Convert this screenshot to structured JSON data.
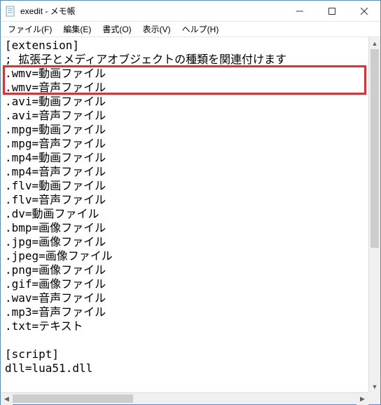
{
  "window": {
    "title": "exedit - メモ帳"
  },
  "menu": {
    "file": "ファイル(F)",
    "edit": "編集(E)",
    "format": "書式(O)",
    "view": "表示(V)",
    "help": "ヘルプ(H)"
  },
  "content": {
    "lines": [
      "[extension]",
      "; 拡張子とメディアオブジェクトの種類を関連付けます",
      ".wmv=動画ファイル",
      ".wmv=音声ファイル",
      ".avi=動画ファイル",
      ".avi=音声ファイル",
      ".mpg=動画ファイル",
      ".mpg=音声ファイル",
      ".mp4=動画ファイル",
      ".mp4=音声ファイル",
      ".flv=動画ファイル",
      ".flv=音声ファイル",
      ".dv=動画ファイル",
      ".bmp=画像ファイル",
      ".jpg=画像ファイル",
      ".jpeg=画像ファイル",
      ".png=画像ファイル",
      ".gif=画像ファイル",
      ".wav=音声ファイル",
      ".mp3=音声ファイル",
      ".txt=テキスト",
      "",
      "[script]",
      "dll=lua51.dll"
    ]
  },
  "highlight": {
    "first_line_index": 2,
    "last_line_index": 3
  }
}
